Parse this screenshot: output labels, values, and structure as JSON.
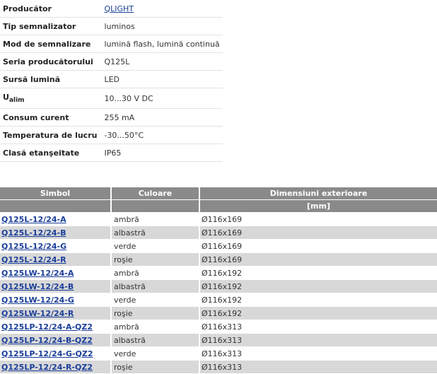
{
  "attributes": [
    {
      "label": "Producător",
      "value": "QLIGHT",
      "link": true
    },
    {
      "label": "Tip semnalizator",
      "value": "luminos"
    },
    {
      "label": "Mod de semnalizare",
      "value": "lumină flash, lumină continuă"
    },
    {
      "label": "Seria producătorului",
      "value": "Q125L"
    },
    {
      "label": "Sursă lumină",
      "value": "LED"
    },
    {
      "label": "U",
      "label_sub": "alim",
      "value": "10...30 V DC"
    },
    {
      "label": "Consum curent",
      "value": "255 mA"
    },
    {
      "label": "Temperatura de lucru",
      "value": "-30...50°C"
    },
    {
      "label": "Clasă etanşeitate",
      "value": "IP65"
    }
  ],
  "products": {
    "headers": [
      "Simbol",
      "Culoare",
      "Dimensiuni exterioare"
    ],
    "subheader_unit": "[mm]",
    "rows": [
      {
        "symbol": "Q125L-12/24-A",
        "color": "ambră",
        "dim": "Ø116x169"
      },
      {
        "symbol": "Q125L-12/24-B",
        "color": "albastră",
        "dim": "Ø116x169"
      },
      {
        "symbol": "Q125L-12/24-G",
        "color": "verde",
        "dim": "Ø116x169"
      },
      {
        "symbol": "Q125L-12/24-R",
        "color": "roşie",
        "dim": "Ø116x169"
      },
      {
        "symbol": "Q125LW-12/24-A",
        "color": "ambră",
        "dim": "Ø116x192"
      },
      {
        "symbol": "Q125LW-12/24-B",
        "color": "albastră",
        "dim": "Ø116x192"
      },
      {
        "symbol": "Q125LW-12/24-G",
        "color": "verde",
        "dim": "Ø116x192"
      },
      {
        "symbol": "Q125LW-12/24-R",
        "color": "roşie",
        "dim": "Ø116x192"
      },
      {
        "symbol": "Q125LP-12/24-A-QZ2",
        "color": "ambră",
        "dim": "Ø116x313"
      },
      {
        "symbol": "Q125LP-12/24-B-QZ2",
        "color": "albastră",
        "dim": "Ø116x313"
      },
      {
        "symbol": "Q125LP-12/24-G-QZ2",
        "color": "verde",
        "dim": "Ø116x313"
      },
      {
        "symbol": "Q125LP-12/24-R-QZ2",
        "color": "roşie",
        "dim": "Ø116x313"
      }
    ]
  },
  "colors": {
    "link": "#1a3e99",
    "header_bg": "#8a8a8a",
    "row_alt_bg": "#d8d8d8"
  }
}
